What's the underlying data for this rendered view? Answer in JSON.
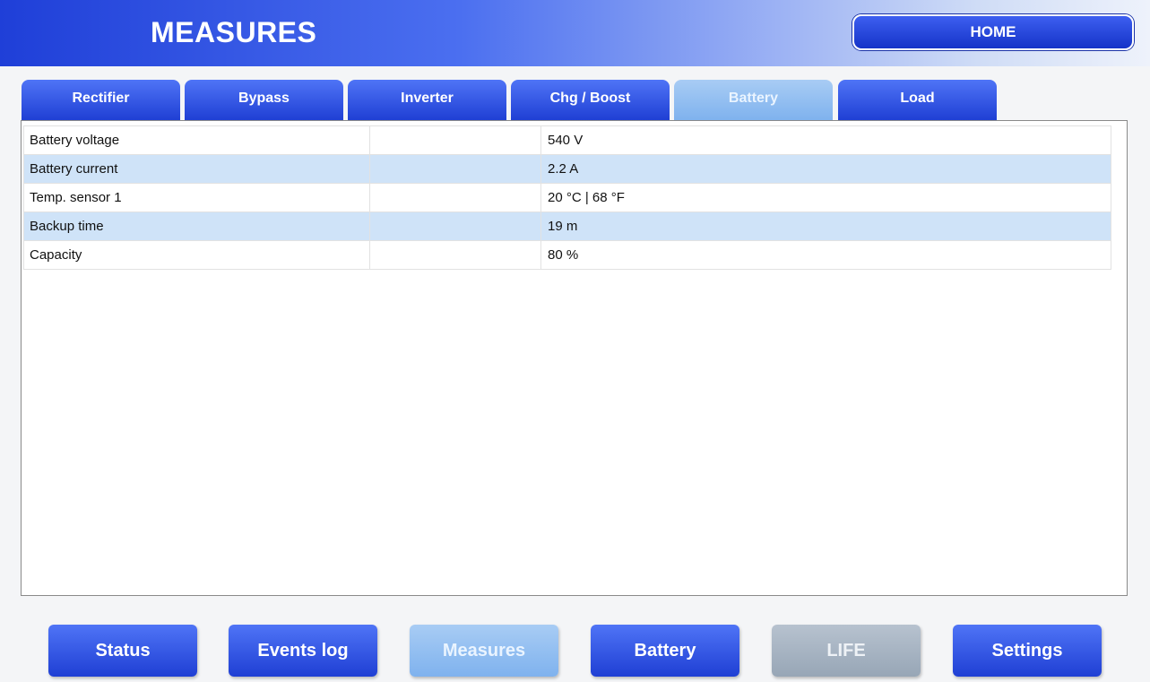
{
  "header": {
    "title": "MEASURES",
    "home_label": "HOME"
  },
  "tabs": [
    {
      "label": "Rectifier"
    },
    {
      "label": "Bypass"
    },
    {
      "label": "Inverter"
    },
    {
      "label": "Chg / Boost"
    },
    {
      "label": "Battery",
      "active": true
    },
    {
      "label": "Load"
    }
  ],
  "measures": [
    {
      "name": "Battery voltage",
      "value": "540 V"
    },
    {
      "name": "Battery current",
      "value": "2.2 A"
    },
    {
      "name": "Temp. sensor 1",
      "value": "20 °C | 68 °F"
    },
    {
      "name": "Backup time",
      "value": "19 m"
    },
    {
      "name": "Capacity",
      "value": "80 %"
    }
  ],
  "nav": [
    {
      "label": "Status"
    },
    {
      "label": "Events log"
    },
    {
      "label": "Measures",
      "active": true
    },
    {
      "label": "Battery"
    },
    {
      "label": "LIFE",
      "disabled": true
    },
    {
      "label": "Settings"
    }
  ],
  "colors": {
    "primary_blue": "#1f3fd4",
    "active_light_blue": "#8ebcf0",
    "row_highlight": "#cfe3f8",
    "disabled_gray": "#a6b3c2"
  }
}
